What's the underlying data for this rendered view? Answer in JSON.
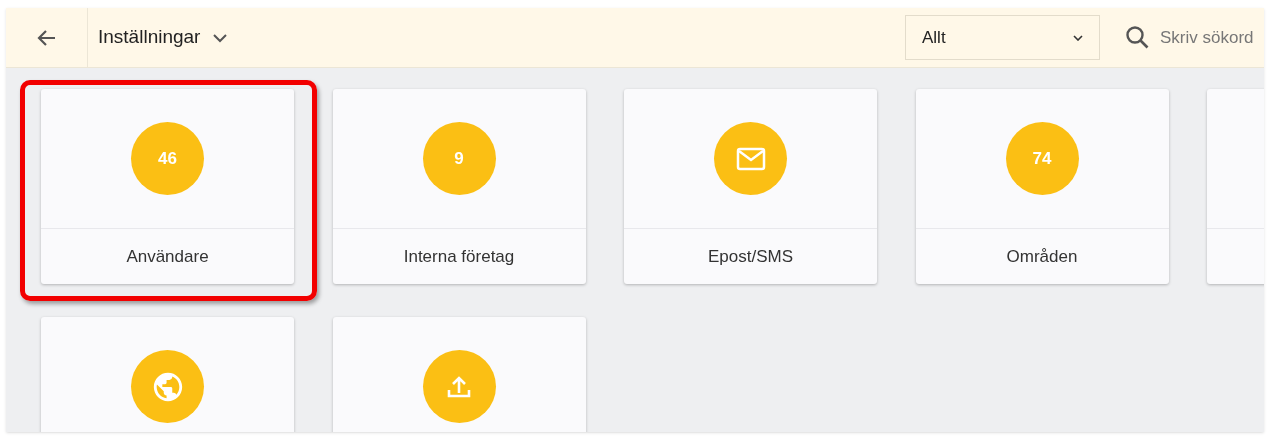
{
  "header": {
    "title": "Inställningar",
    "filter": {
      "value": "Allt"
    },
    "search": {
      "placeholder": "Skriv sökord"
    }
  },
  "tiles": [
    {
      "kind": "count",
      "count": "46",
      "label": "Användare",
      "highlighted": true
    },
    {
      "kind": "count",
      "count": "9",
      "label": "Interna företag"
    },
    {
      "kind": "mail",
      "label": "Epost/SMS"
    },
    {
      "kind": "count",
      "count": "74",
      "label": "Områden"
    },
    {
      "kind": "blank"
    },
    {
      "kind": "globe"
    },
    {
      "kind": "upload"
    }
  ]
}
